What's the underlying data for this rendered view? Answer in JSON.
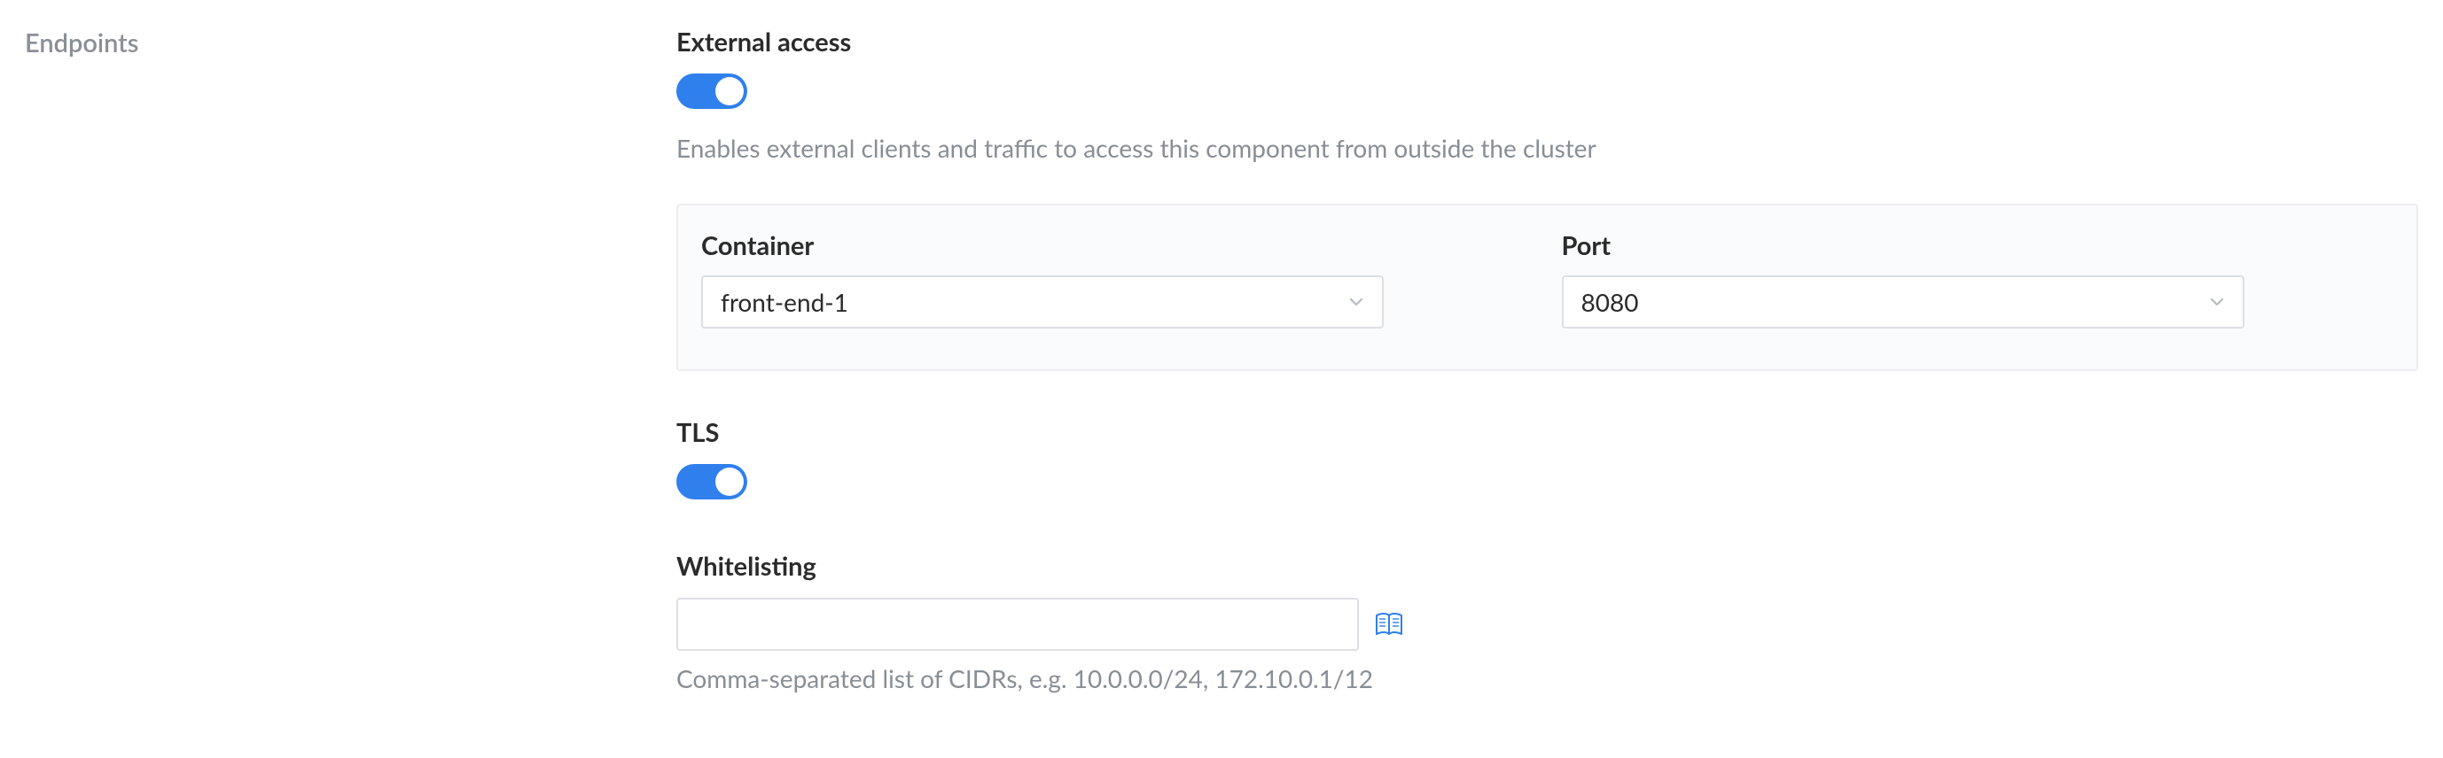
{
  "sidebar": {
    "label": "Endpoints"
  },
  "externalAccess": {
    "heading": "External access",
    "enabled": true,
    "description": "Enables external clients and traffic to access this component from outside the cluster",
    "containerLabel": "Container",
    "containerValue": "front-end-1",
    "portLabel": "Port",
    "portValue": "8080"
  },
  "tls": {
    "heading": "TLS",
    "enabled": true
  },
  "whitelisting": {
    "heading": "Whitelisting",
    "value": "",
    "hint": "Comma-separated list of CIDRs, e.g. 10.0.0.0/24, 172.10.0.1/12"
  }
}
